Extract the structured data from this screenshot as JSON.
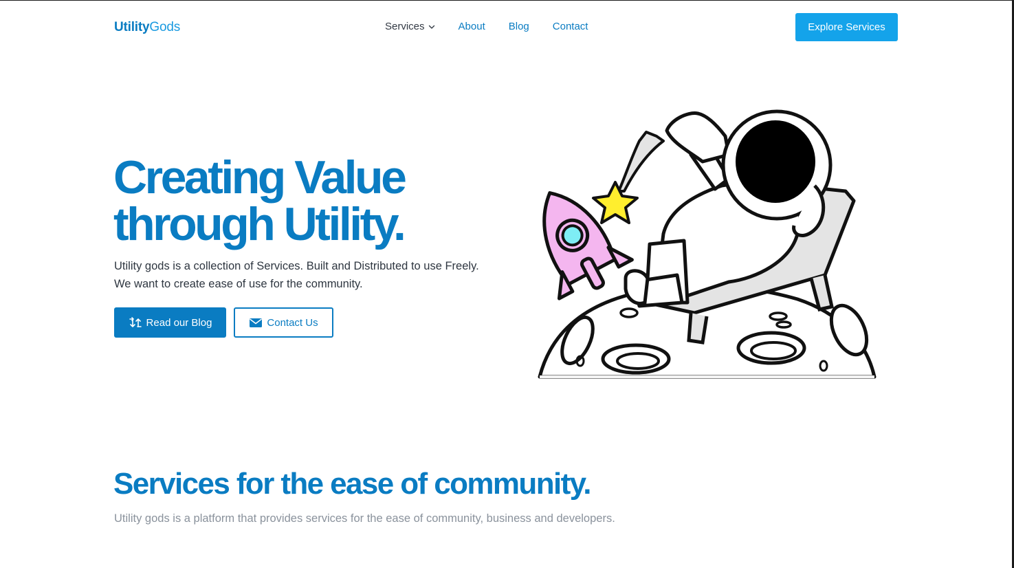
{
  "header": {
    "logo_bold": "Utility",
    "logo_light": "Gods",
    "nav": {
      "services": "Services",
      "about": "About",
      "blog": "Blog",
      "contact": "Contact"
    },
    "cta": "Explore Services"
  },
  "hero": {
    "title_line1": "Creating Value",
    "title_line2": "through Utility.",
    "description": "Utility gods is a collection of Services. Built and Distributed to use Freely. We want to create ease of use for the community.",
    "primary_button": "Read our Blog",
    "secondary_button": "Contact Us"
  },
  "services": {
    "title": "Services for the ease of community.",
    "description": "Utility gods is a platform that provides services for the ease of community, business and developers."
  },
  "colors": {
    "brand": "#0a7cc2",
    "accent": "#14a3ea",
    "rocket": "#f4b6ef",
    "rocket_window": "#7eedf5",
    "star": "#ffee2e"
  },
  "icons": {
    "services_chevron": "chevron-down-icon",
    "blog_button": "arrows-exchange-icon",
    "contact_button": "mail-icon"
  }
}
